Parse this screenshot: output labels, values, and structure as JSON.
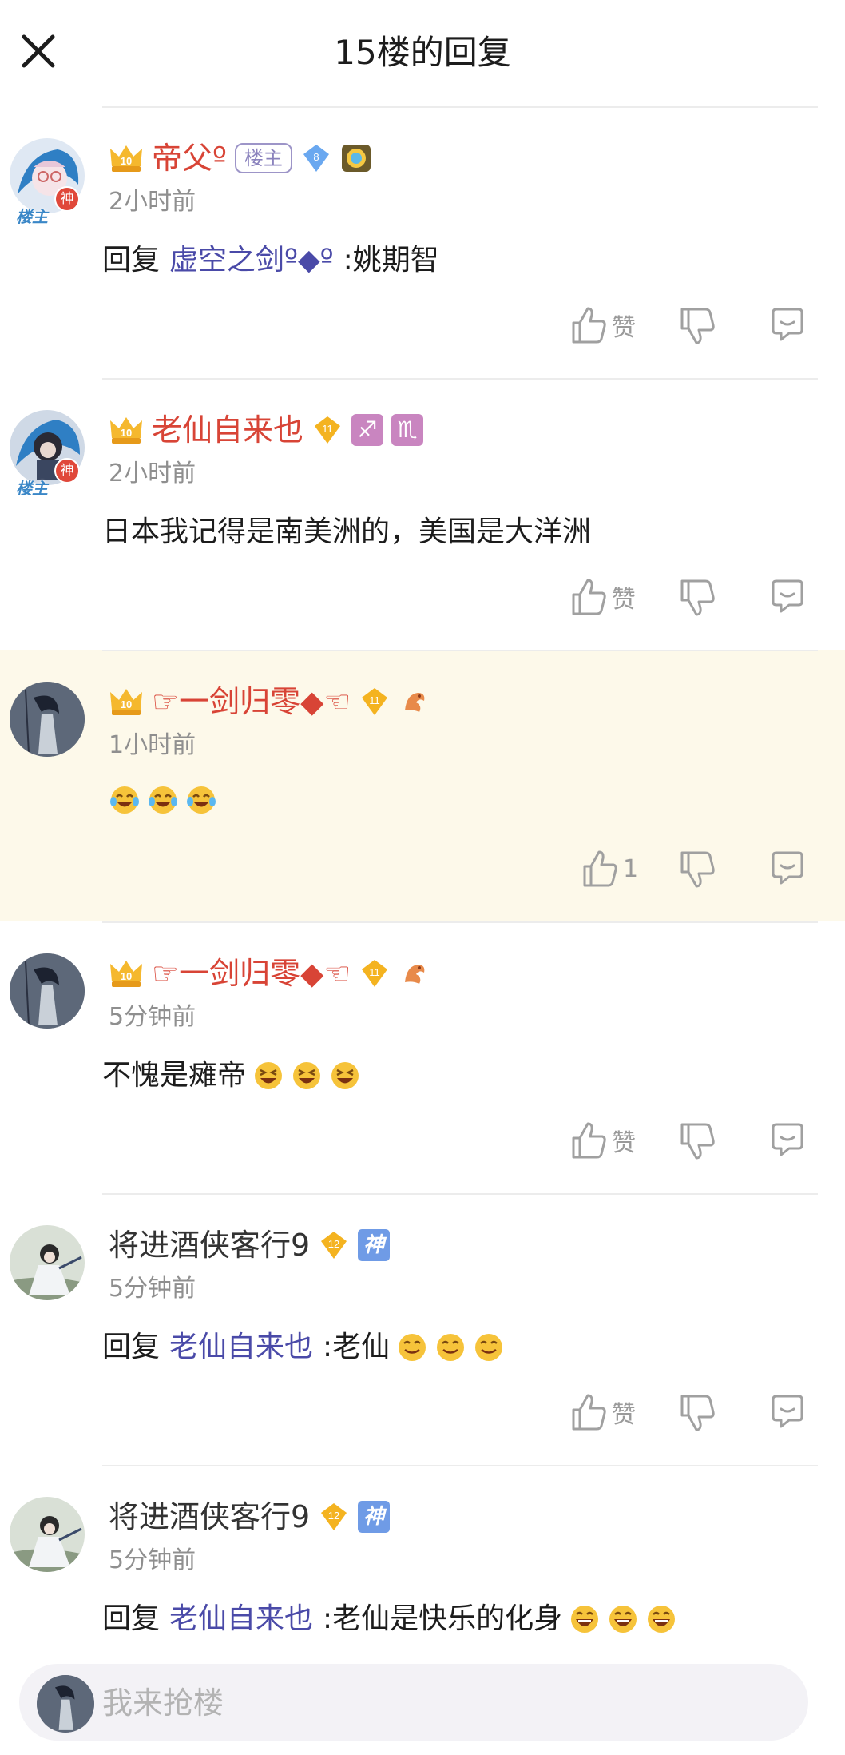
{
  "header": {
    "title": "15楼的回复",
    "close_icon": "close-icon"
  },
  "colors": {
    "vip_name": "#d84436",
    "reply_link": "#4a4aa8",
    "highlight_bg": "#fdf9ea"
  },
  "comments": [
    {
      "username": "帝父º",
      "owner_tag": "楼主",
      "level_badge": "8",
      "time": "2小时前",
      "reply_prefix": "回复",
      "reply_target": "虚空之剑º◆º",
      "text": ":姚期智",
      "like_label": "赞"
    },
    {
      "username": "老仙自来也",
      "level_badge": "11",
      "zodiac1": "♐",
      "zodiac2": "♏",
      "time": "2小时前",
      "text": "日本我记得是南美洲的，美国是大洋洲",
      "like_label": "赞"
    },
    {
      "username": "☞一剑归零◆☜",
      "level_badge": "11",
      "time": "1小时前",
      "text": "",
      "like_label": "1"
    },
    {
      "username": "☞一剑归零◆☜",
      "level_badge": "11",
      "time": "5分钟前",
      "text": "不愧是瘫帝",
      "like_label": "赞"
    },
    {
      "username": "将进酒侠客行9",
      "level_badge": "12",
      "shen_tag": "神",
      "time": "5分钟前",
      "reply_prefix": "回复",
      "reply_target": "老仙自来也",
      "text": ":老仙",
      "like_label": "赞"
    },
    {
      "username": "将进酒侠客行9",
      "level_badge": "12",
      "shen_tag": "神",
      "time": "5分钟前",
      "reply_prefix": "回复",
      "reply_target": "老仙自来也",
      "text": ":老仙是快乐的化身",
      "like_label": "赞"
    }
  ],
  "avatar_badges": {
    "god": "神",
    "owner": "楼主"
  },
  "bottom_bar": {
    "placeholder": "我来抢楼"
  }
}
